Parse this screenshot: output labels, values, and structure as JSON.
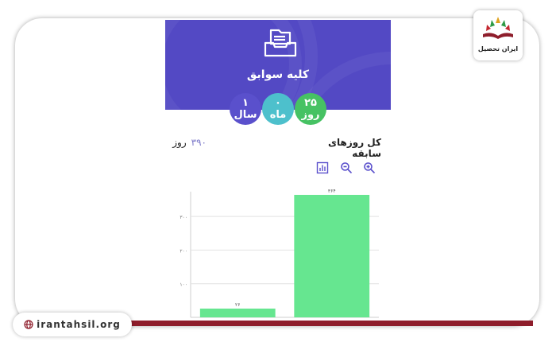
{
  "header": {
    "title": "کلیه سوابق",
    "icon": "folder-tray-icon",
    "background": "#5349c4"
  },
  "badges": [
    {
      "value": "۲۵",
      "unit": "روز",
      "color": "#46c263"
    },
    {
      "value": "۰",
      "unit": "ماه",
      "color": "#4dc0cc"
    },
    {
      "value": "۱",
      "unit": "سال",
      "color": "#5a50cc"
    }
  ],
  "total": {
    "label": "کل روزهای سابقه",
    "value": "۳۹۰",
    "unit": "روز"
  },
  "toolbar": {
    "icons": [
      "zoom-in-icon",
      "zoom-out-icon",
      "bar-chart-icon"
    ]
  },
  "chart_data": {
    "type": "bar",
    "categories": [
      "",
      ""
    ],
    "values": [
      26,
      364
    ],
    "value_labels": [
      "۲۶",
      "۳۶۴"
    ],
    "yticks": [
      "۱۰۰",
      "۲۰۰",
      "۳۰۰"
    ],
    "ytick_values": [
      100,
      200,
      300
    ],
    "ylim": [
      0,
      364
    ],
    "bar_color": "#66e690",
    "grid": true
  },
  "site": {
    "name": "irantahsil.org",
    "icon": "globe-icon",
    "accent": "#8e1d2b"
  },
  "logo": {
    "text": "ایران تحصیل",
    "icon": "book-icon"
  }
}
